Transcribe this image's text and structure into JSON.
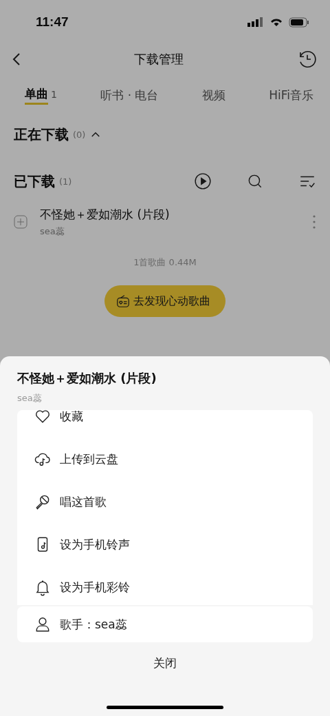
{
  "status_bar": {
    "time": "11:47"
  },
  "nav": {
    "title": "下载管理"
  },
  "tabs": [
    {
      "label": "单曲",
      "count": "1",
      "selected": true
    },
    {
      "label": "听书 · 电台",
      "selected": false
    },
    {
      "label": "视频",
      "selected": false
    },
    {
      "label": "HiFi音乐",
      "selected": false
    }
  ],
  "downloading": {
    "title": "正在下载",
    "count": "(0)",
    "expanded": true
  },
  "downloaded": {
    "title": "已下载",
    "count": "(1)"
  },
  "songs": [
    {
      "title": "不怪她＋爱如潮水 (片段)",
      "artist": "sea蕊"
    }
  ],
  "summary": "1首歌曲 0.44M",
  "discover_button": "去发现心动歌曲",
  "sheet": {
    "title": "不怪她＋爱如潮水 (片段)",
    "subtitle": "sea蕊",
    "actions": [
      {
        "kind": "favorite",
        "label": "收藏"
      },
      {
        "kind": "cloud",
        "label": "上传到云盘"
      },
      {
        "kind": "sing",
        "label": "唱这首歌"
      },
      {
        "kind": "ringtone",
        "label": "设为手机铃声"
      },
      {
        "kind": "bell",
        "label": "设为手机彩铃"
      }
    ],
    "singer": {
      "label": "歌手：sea蕊"
    },
    "close": "关闭"
  }
}
